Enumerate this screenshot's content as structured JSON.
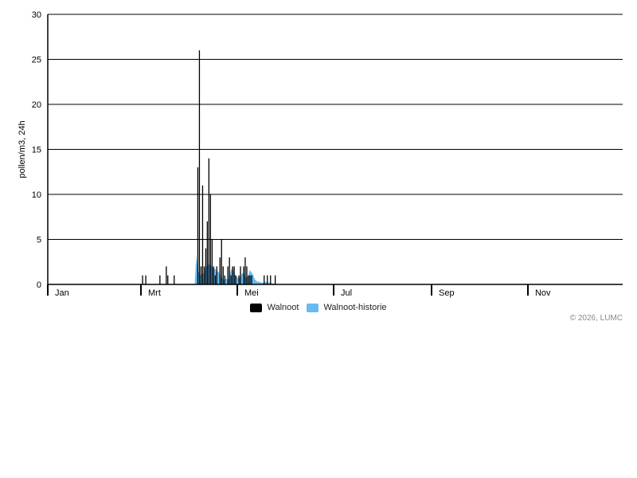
{
  "chart_data": {
    "type": "bar",
    "title": "",
    "xlabel": "",
    "ylabel": "pollen/m3, 24h",
    "ylim": [
      0,
      30
    ],
    "y_ticks": [
      0,
      5,
      10,
      15,
      20,
      25,
      30
    ],
    "x_ticks": [
      "Jan",
      "Mrt",
      "Mei",
      "Jul",
      "Sep",
      "Nov"
    ],
    "x_tick_day_of_year": [
      1,
      60,
      121,
      182,
      244,
      305
    ],
    "x_range_day_of_year": [
      1,
      365
    ],
    "grid": true,
    "legend_position": "bottom",
    "series": [
      {
        "name": "Walnoot",
        "type": "bar",
        "color": "#000000",
        "x_day_of_year": [
          61,
          63,
          72,
          76,
          77,
          81,
          96,
          97,
          98,
          99,
          100,
          101,
          102,
          103,
          104,
          105,
          106,
          107,
          108,
          110,
          111,
          112,
          113,
          115,
          116,
          117,
          118,
          119,
          120,
          122,
          123,
          125,
          126,
          127,
          128,
          129,
          130,
          138,
          140,
          142,
          145
        ],
        "values": [
          1,
          1,
          1,
          2,
          1,
          1,
          13,
          26,
          2,
          11,
          2,
          4,
          7,
          14,
          10,
          5,
          2,
          1,
          2,
          3,
          5,
          2,
          1,
          2,
          3,
          1,
          2,
          2,
          1,
          1,
          2,
          2,
          3,
          2,
          1,
          1,
          1,
          1,
          1,
          1,
          1
        ]
      },
      {
        "name": "Walnoot-historie",
        "type": "area",
        "color": "#67bbf0",
        "x_day_of_year": [
          94,
          95,
          96,
          97,
          98,
          99,
          100,
          101,
          102,
          103,
          104,
          105,
          106,
          107,
          108,
          109,
          110,
          111,
          112,
          113,
          114,
          115,
          116,
          117,
          118,
          119,
          120,
          121,
          122,
          123,
          124,
          125,
          126,
          127,
          128,
          129,
          130,
          131,
          132,
          133,
          134,
          135,
          136,
          137,
          138,
          139,
          140,
          141,
          142,
          143,
          144,
          145,
          146
        ],
        "values": [
          0,
          3.2,
          1.6,
          1.2,
          0.9,
          1.4,
          1.1,
          2.2,
          1.8,
          2.6,
          1.9,
          2.2,
          1.6,
          1.8,
          1.2,
          1.5,
          1.1,
          0.8,
          0.6,
          0.5,
          0.7,
          0.4,
          0.9,
          1.6,
          1.8,
          1.2,
          1,
          0.8,
          0.6,
          0.9,
          1.2,
          1.3,
          0.9,
          0.7,
          1,
          1.6,
          1.3,
          1.1,
          0.6,
          0.4,
          0.3,
          0.3,
          0.2,
          0.2,
          0.2,
          0.3,
          0.2,
          0.2,
          0.2,
          0.1,
          0.1,
          0.1,
          0
        ]
      }
    ]
  },
  "credit": "© 2026, LUMC"
}
